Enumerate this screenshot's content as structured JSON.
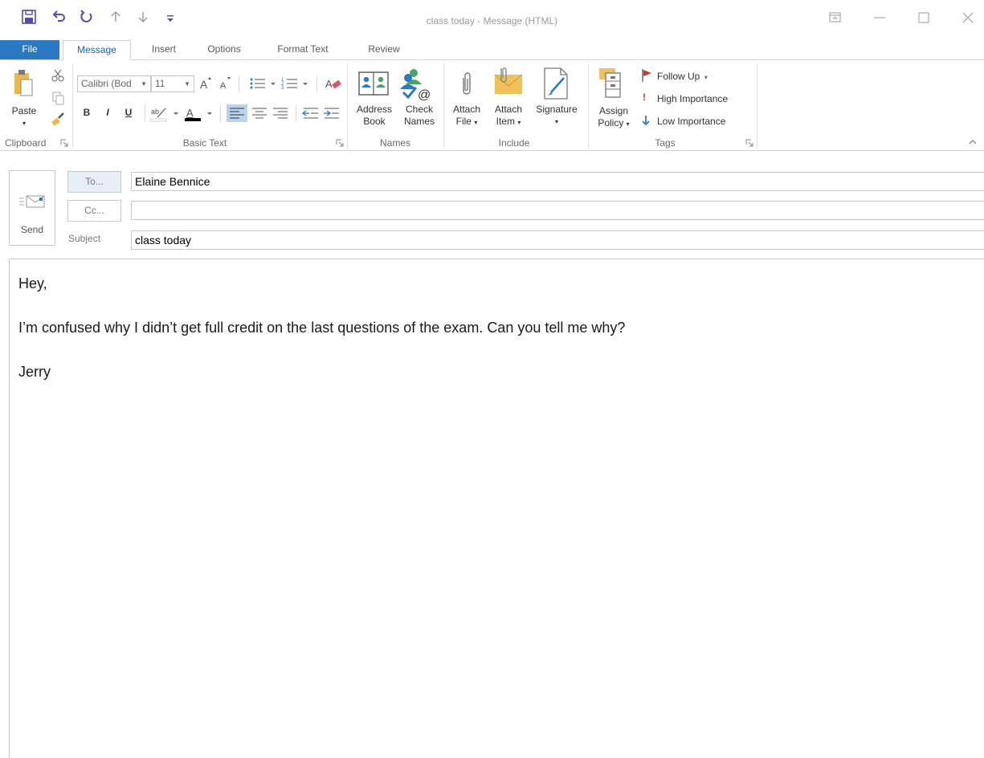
{
  "window": {
    "title": "class today - Message (HTML)"
  },
  "tabs": {
    "file": "File",
    "message": "Message",
    "insert": "Insert",
    "options": "Options",
    "format_text": "Format Text",
    "review": "Review"
  },
  "ribbon": {
    "clipboard": {
      "paste": "Paste",
      "label": "Clipboard"
    },
    "basic_text": {
      "font_name": "Calibri (Bod",
      "font_size": "11",
      "bold": "B",
      "italic": "I",
      "underline": "U",
      "label": "Basic Text"
    },
    "names": {
      "address_book_line1": "Address",
      "address_book_line2": "Book",
      "check_names_line1": "Check",
      "check_names_line2": "Names",
      "label": "Names"
    },
    "include": {
      "attach_file_line1": "Attach",
      "attach_file_line2": "File",
      "attach_item_line1": "Attach",
      "attach_item_line2": "Item",
      "signature": "Signature",
      "label": "Include"
    },
    "tags": {
      "assign_policy_line1": "Assign",
      "assign_policy_line2": "Policy",
      "follow_up": "Follow Up",
      "high_importance": "High Importance",
      "low_importance": "Low Importance",
      "label": "Tags"
    }
  },
  "compose": {
    "send_label": "Send",
    "to_button": "To...",
    "cc_button": "Cc...",
    "subject_label": "Subject",
    "to_value": "Elaine Bennice",
    "cc_value": "",
    "subject_value": "class today"
  },
  "message": {
    "greeting": "Hey,",
    "body": "I’m confused why I didn’t get full credit on the last questions of the exam. Can you tell me why?",
    "signoff": "Jerry"
  },
  "colors": {
    "accent": "#2b79c2",
    "qat_purple": "#5b4aa8",
    "flag_red": "#c0392b",
    "low_importance_blue": "#2b79c2"
  }
}
